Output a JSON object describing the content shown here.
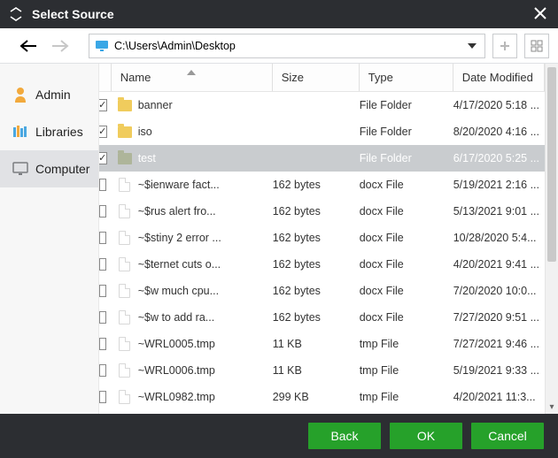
{
  "title": "Select Source",
  "path": "C:\\Users\\Admin\\Desktop",
  "sidebar": {
    "items": [
      {
        "label": "Admin",
        "icon": "user",
        "selected": false
      },
      {
        "label": "Libraries",
        "icon": "library",
        "selected": false
      },
      {
        "label": "Computer",
        "icon": "monitor",
        "selected": true
      }
    ]
  },
  "columns": {
    "name": "Name",
    "size": "Size",
    "type": "Type",
    "date": "Date Modified",
    "sort_on": "name",
    "sort_dir": "asc"
  },
  "files": [
    {
      "checked": true,
      "icon": "folder",
      "name": "banner",
      "size": "",
      "type": "File Folder",
      "date": "4/17/2020 5:18 ...",
      "selected": false
    },
    {
      "checked": true,
      "icon": "folder",
      "name": "iso",
      "size": "",
      "type": "File Folder",
      "date": "8/20/2020 4:16 ...",
      "selected": false
    },
    {
      "checked": true,
      "icon": "folder-dim",
      "name": "test",
      "size": "",
      "type": "File Folder",
      "date": "6/17/2020 5:25 ...",
      "selected": true
    },
    {
      "checked": false,
      "icon": "file",
      "name": "~$ienware fact...",
      "size": "162 bytes",
      "type": "docx File",
      "date": "5/19/2021 2:16 ...",
      "selected": false
    },
    {
      "checked": false,
      "icon": "file",
      "name": "~$rus alert fro...",
      "size": "162 bytes",
      "type": "docx File",
      "date": "5/13/2021 9:01 ...",
      "selected": false
    },
    {
      "checked": false,
      "icon": "file",
      "name": "~$stiny 2 error ...",
      "size": "162 bytes",
      "type": "docx File",
      "date": "10/28/2020 5:4...",
      "selected": false
    },
    {
      "checked": false,
      "icon": "file",
      "name": "~$ternet cuts o...",
      "size": "162 bytes",
      "type": "docx File",
      "date": "4/20/2021 9:41 ...",
      "selected": false
    },
    {
      "checked": false,
      "icon": "file",
      "name": "~$w much cpu...",
      "size": "162 bytes",
      "type": "docx File",
      "date": "7/20/2020 10:0...",
      "selected": false
    },
    {
      "checked": false,
      "icon": "file",
      "name": "~$w to add ra...",
      "size": "162 bytes",
      "type": "docx File",
      "date": "7/27/2020 9:51 ...",
      "selected": false
    },
    {
      "checked": false,
      "icon": "file",
      "name": "~WRL0005.tmp",
      "size": "11 KB",
      "type": "tmp File",
      "date": "7/27/2021 9:46 ...",
      "selected": false
    },
    {
      "checked": false,
      "icon": "file",
      "name": "~WRL0006.tmp",
      "size": "11 KB",
      "type": "tmp File",
      "date": "5/19/2021 9:33 ...",
      "selected": false
    },
    {
      "checked": false,
      "icon": "file",
      "name": "~WRL0982.tmp",
      "size": "299 KB",
      "type": "tmp File",
      "date": "4/20/2021 11:3...",
      "selected": false
    }
  ],
  "buttons": {
    "back": "Back",
    "ok": "OK",
    "cancel": "Cancel"
  }
}
